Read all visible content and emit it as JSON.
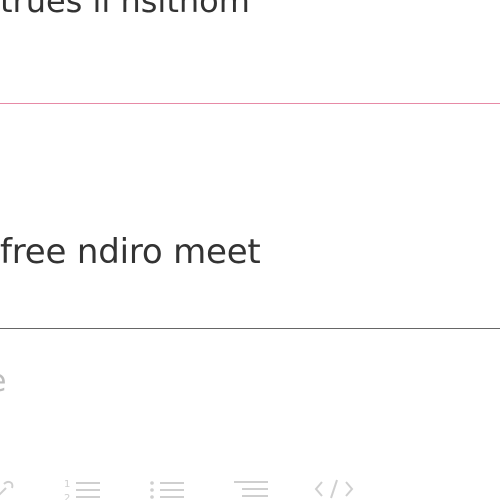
{
  "fields": {
    "top_value": "trues il nsithom",
    "main_value": "free ndiro meet",
    "placeholder_partial": "e"
  },
  "toolbar": {
    "buttons": [
      {
        "name": "link-icon"
      },
      {
        "name": "ordered-list-icon"
      },
      {
        "name": "unordered-list-icon"
      },
      {
        "name": "indent-list-icon"
      },
      {
        "name": "code-icon"
      }
    ]
  },
  "colors": {
    "text": "#333333",
    "placeholder": "#bdbdbd",
    "focus_underline": "#e78aa6",
    "underline": "#666666",
    "toolbar_icon": "#cfcfcf"
  }
}
